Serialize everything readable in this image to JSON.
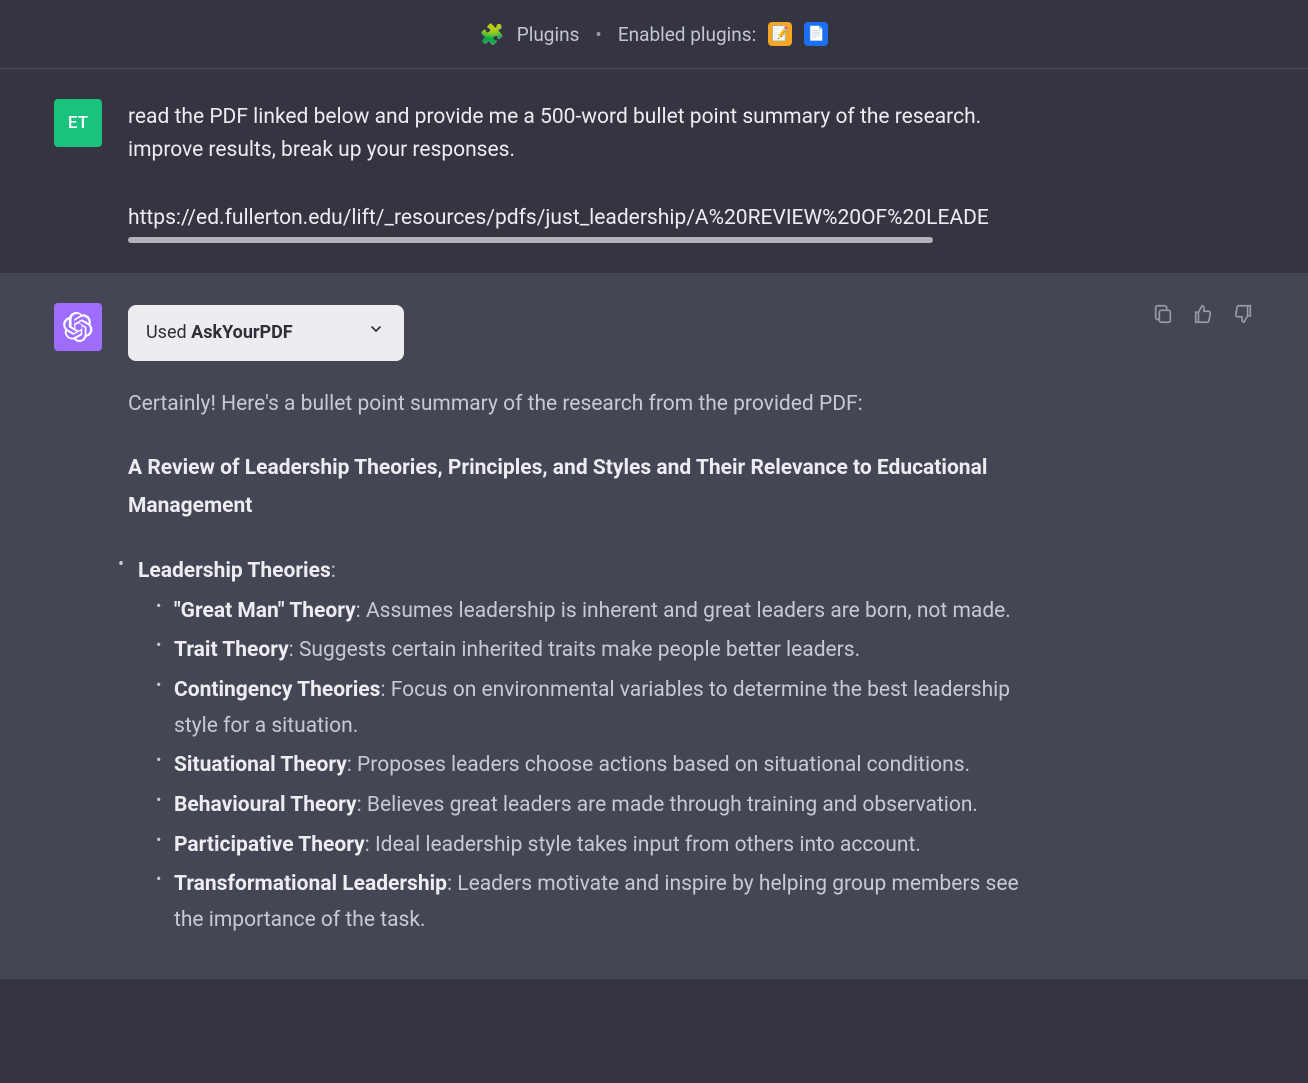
{
  "header": {
    "plugins_label": "Plugins",
    "enabled_label": "Enabled plugins:"
  },
  "user_message": {
    "avatar_initials": "ET",
    "text_line1": "read the PDF linked below and provide me a 500-word bullet point summary of the research.",
    "text_line2": "improve results, break up your responses.",
    "url": "https://ed.fullerton.edu/lift/_resources/pdfs/just_leadership/A%20REVIEW%20OF%20LEADE"
  },
  "assistant_message": {
    "plugin_pill": {
      "used_label": "Used ",
      "plugin_name": "AskYourPDF"
    },
    "intro": "Certainly! Here's a bullet point summary of the research from the provided PDF:",
    "title": "A Review of Leadership Theories, Principles, and Styles and Their Relevance to Educational Management",
    "section_heading": "Leadership Theories",
    "section_colon": ":",
    "bullets": [
      {
        "term": "\"Great Man\" Theory",
        "desc": ": Assumes leadership is inherent and great leaders are born, not made."
      },
      {
        "term": "Trait Theory",
        "desc": ": Suggests certain inherited traits make people better leaders."
      },
      {
        "term": "Contingency Theories",
        "desc": ": Focus on environmental variables to determine the best leadership style for a situation."
      },
      {
        "term": "Situational Theory",
        "desc": ": Proposes leaders choose actions based on situational conditions."
      },
      {
        "term": "Behavioural Theory",
        "desc": ": Believes great leaders are made through training and observation."
      },
      {
        "term": "Participative Theory",
        "desc": ": Ideal leadership style takes input from others into account."
      },
      {
        "term": "Transformational Leadership",
        "desc": ": Leaders motivate and inspire by helping group members see the importance of the task."
      }
    ]
  }
}
